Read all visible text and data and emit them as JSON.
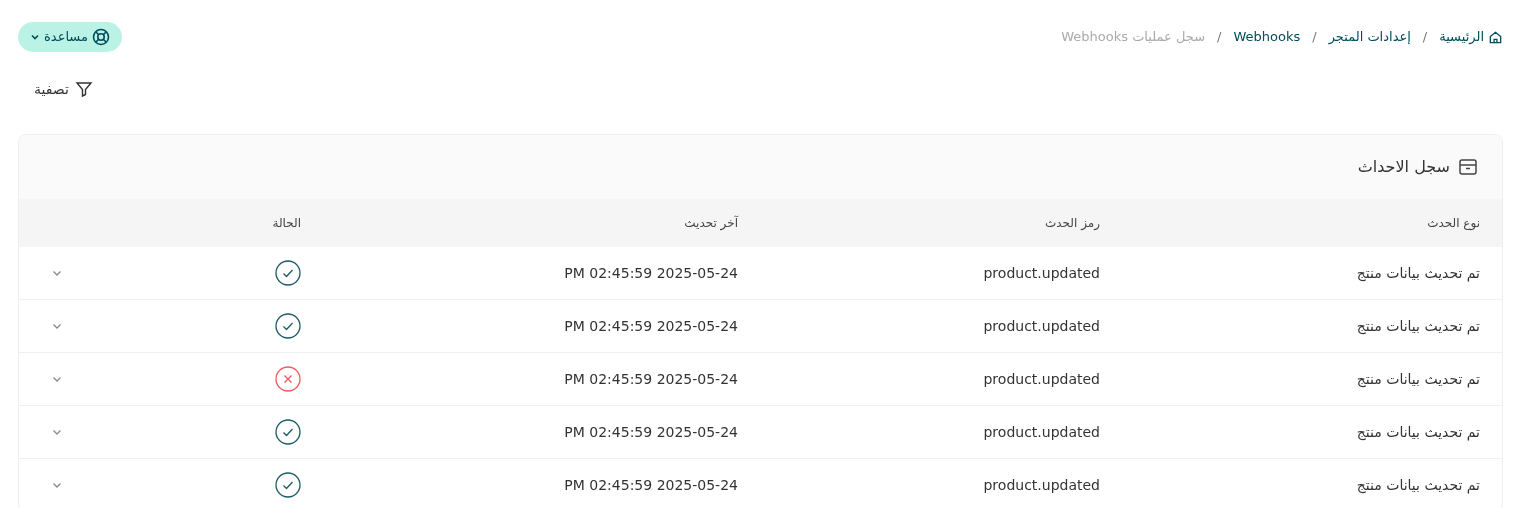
{
  "breadcrumb": [
    {
      "label": "الرئيسية",
      "kind": "home",
      "current": false
    },
    {
      "label": "إعدادات المتجر",
      "kind": "link",
      "current": false
    },
    {
      "label": "Webhooks",
      "kind": "link",
      "current": false
    },
    {
      "label": "سجل عمليات Webhooks",
      "kind": "link",
      "current": true
    }
  ],
  "breadcrumb_separator": "/",
  "help_button": {
    "label": "مساعدة"
  },
  "filter_button": {
    "label": "تصفية"
  },
  "card": {
    "title": "سجل الاحداث",
    "columns": [
      "نوع الحدث",
      "رمز الحدث",
      "آخر تحديث",
      "الحالة"
    ],
    "rows": [
      {
        "event_type": "تم تحديث بيانات منتج",
        "event_code": "product.updated",
        "updated": "2025-05-24 02:45:59 PM",
        "succeeded": true,
        "expanded": false
      },
      {
        "event_type": "تم تحديث بيانات منتج",
        "event_code": "product.updated",
        "updated": "2025-05-24 02:45:59 PM",
        "succeeded": true,
        "expanded": false
      },
      {
        "event_type": "تم تحديث بيانات منتج",
        "event_code": "product.updated",
        "updated": "2025-05-24 02:45:59 PM",
        "succeeded": false,
        "expanded": false
      },
      {
        "event_type": "تم تحديث بيانات منتج",
        "event_code": "product.updated",
        "updated": "2025-05-24 02:45:59 PM",
        "succeeded": true,
        "expanded": false
      },
      {
        "event_type": "تم تحديث بيانات منتج",
        "event_code": "product.updated",
        "updated": "2025-05-24 02:45:59 PM",
        "succeeded": true,
        "expanded": false
      }
    ]
  }
}
